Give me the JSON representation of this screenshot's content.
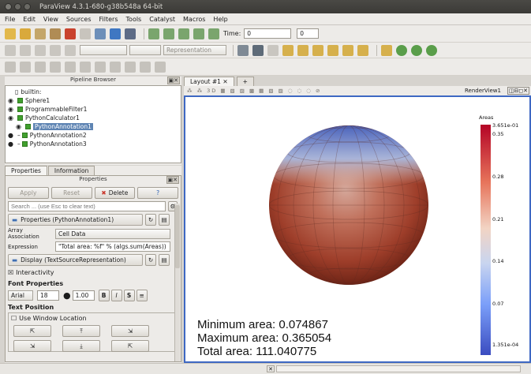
{
  "window": {
    "title": "ParaView 4.3.1-680-g38b548a 64-bit"
  },
  "menu": [
    "File",
    "Edit",
    "View",
    "Sources",
    "Filters",
    "Tools",
    "Catalyst",
    "Macros",
    "Help"
  ],
  "toolbar": {
    "time_label": "Time:",
    "time_value": "0",
    "time_step": "0",
    "representation": "Representation"
  },
  "pipeline": {
    "title": "Pipeline Browser",
    "items": [
      {
        "label": "builtin:"
      },
      {
        "label": "Sphere1"
      },
      {
        "label": "ProgrammableFilter1"
      },
      {
        "label": "PythonCalculator1"
      },
      {
        "label": "PythonAnnotation1"
      },
      {
        "label": "PythonAnnotation2"
      },
      {
        "label": "PythonAnnotation3"
      }
    ]
  },
  "panel_tabs": [
    "Properties",
    "Information"
  ],
  "properties": {
    "title": "Properties",
    "apply": "Apply",
    "reset": "Reset",
    "delete": "Delete",
    "help": "?",
    "search_placeholder": "Search ... (use Esc to clear text)",
    "section_props": "Properties (PythonAnnotation1)",
    "array_assoc_label": "Array Association",
    "array_assoc_value": "Cell Data",
    "expression_label": "Expression",
    "expression_value": "\"Total area: %f\" % (algs.sum(Areas))",
    "section_display": "Display (TextSourceRepresentation)",
    "interactivity": "Interactivity",
    "font_props": "Font Properties",
    "font_family": "Arial",
    "font_size": "18",
    "opacity": "1.00",
    "text_position": "Text Position",
    "use_window_location": "Use Window Location"
  },
  "layout": {
    "tab": "Layout #1",
    "plus": "+",
    "render_view": "RenderView1"
  },
  "annotations": [
    "Minimum area: 0.074867",
    "Maximum area: 0.365054",
    "Total area: 111.040775"
  ],
  "legend": {
    "title": "Areas",
    "max": "3.651e-01",
    "ticks": [
      "0.35",
      "0.28",
      "0.21",
      "0.14",
      "0.07"
    ],
    "min": "1.351e-04"
  },
  "colors": {
    "accent": "#3e68c3",
    "selection": "#5e84b3"
  }
}
